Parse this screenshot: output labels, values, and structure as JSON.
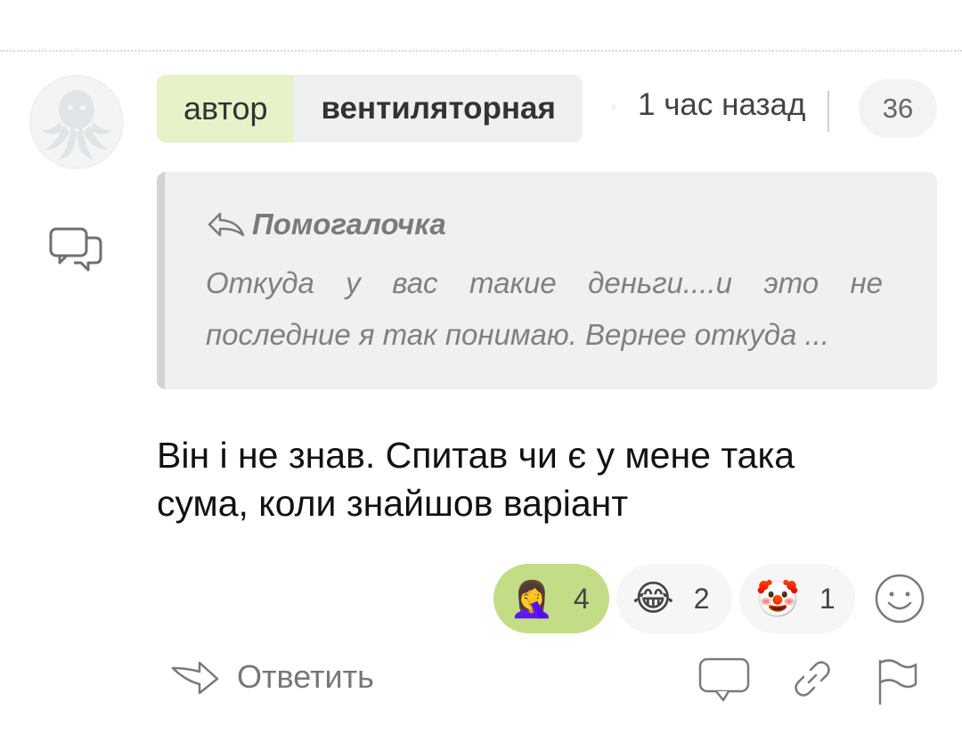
{
  "comment": {
    "author_tag": "автор",
    "author_name": "вентиляторная",
    "time": "1 час назад",
    "count": "36",
    "quote": {
      "author": "Помогалочка",
      "line1_words": [
        "Откуда",
        "у",
        "вас",
        "такие",
        "деньги....и",
        "это",
        "не"
      ],
      "line2": "последние я так понимаю. Вернее откуда ..."
    },
    "text": "Він і не знав. Спитав чи є у мене така сума, коли знайшов варіант",
    "reactions": [
      {
        "emoji": "🤦‍♀️",
        "icon": "facepalm-icon",
        "count": "4",
        "active": true
      },
      {
        "emoji": "😂",
        "icon": "tears-of-joy-icon",
        "count": "2",
        "active": false
      },
      {
        "emoji": "🤡",
        "icon": "clown-icon",
        "count": "1",
        "active": false
      }
    ],
    "actions": {
      "reply_label": "Ответить"
    }
  },
  "colors": {
    "author_tag_bg": "#e6f2c8",
    "active_reaction_bg": "#c2dd86",
    "quote_bg": "#f0f0f0",
    "icon_gray": "#7a7a7a"
  }
}
